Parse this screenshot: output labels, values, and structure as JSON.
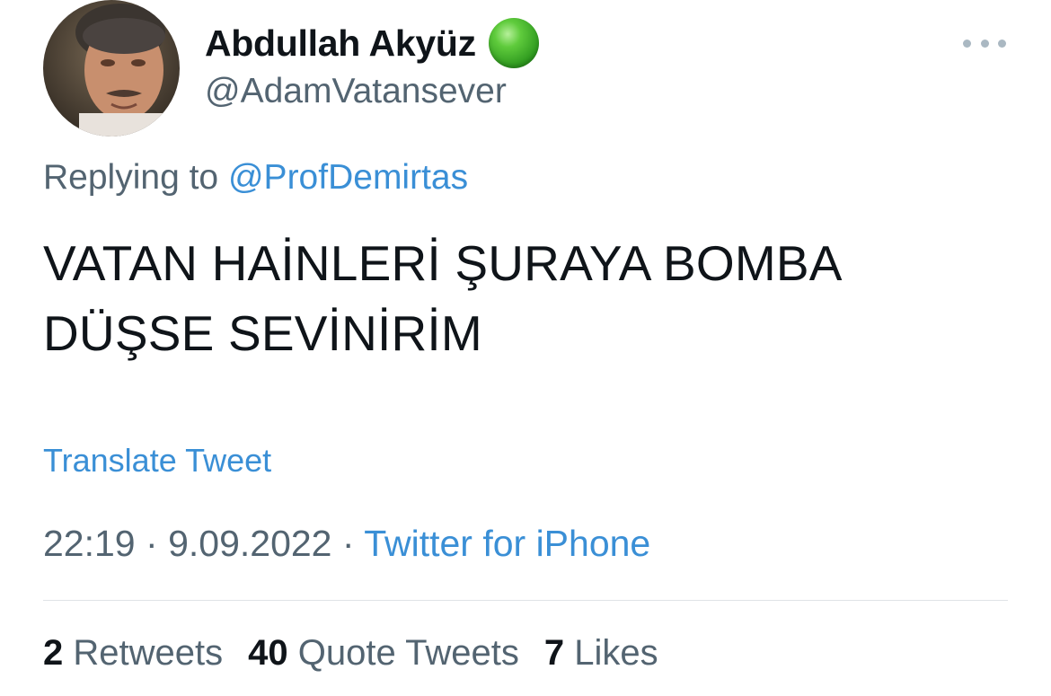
{
  "tweet": {
    "author": {
      "display_name": "Abdullah Akyüz",
      "username": "@AdamVatansever",
      "status_emoji": "green-circle-icon",
      "avatar": "profile-photo"
    },
    "replying_to_label": "Replying to",
    "replying_to_handle": "@ProfDemirtas",
    "text_line_1": "VATAN HAİNLERİ ŞURAYA BOMBA",
    "text_line_2": "DÜŞSE SEVİNİRİM",
    "translate_label": "Translate Tweet",
    "time": "22:19",
    "date": "9.09.2022",
    "separator": "·",
    "source": "Twitter for iPhone",
    "stats": {
      "retweets_count": "2",
      "retweets_label": "Retweets",
      "quotes_count": "40",
      "quotes_label": "Quote Tweets",
      "likes_count": "7",
      "likes_label": "Likes"
    }
  },
  "colors": {
    "link": "#3a8fd6",
    "secondary_text": "#536471",
    "primary_text": "#0f1419",
    "status_emoji": "#3fb22a"
  }
}
